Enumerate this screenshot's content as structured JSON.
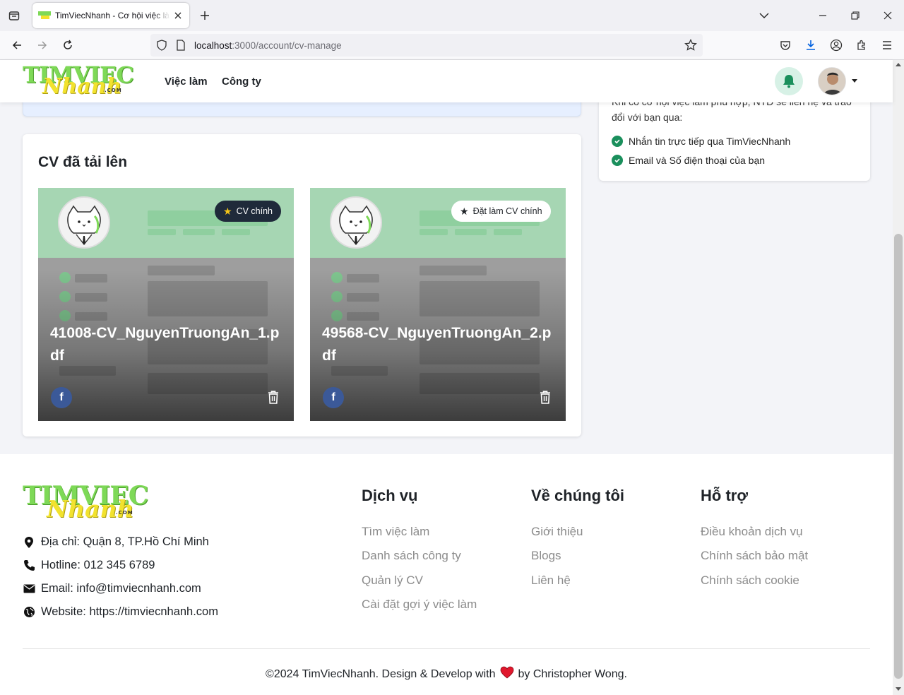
{
  "browser": {
    "tab_title": "TimViecNhanh - Cơ hội việc làm",
    "url_host": "localhost",
    "url_rest": ":3000/account/cv-manage"
  },
  "header": {
    "logo_top": "TIMVIEC",
    "logo_bottom": "Nhanh",
    "logo_com": ".COM",
    "menu": [
      "Việc làm",
      "Công ty"
    ]
  },
  "sidebar_card": {
    "clipped_text": "Khi có cơ hội việc làm phù hợp, NTD sẽ liên hệ và trao đổi với bạn qua:",
    "items": [
      "Nhắn tin trực tiếp qua TimViecNhanh",
      "Email và Số điện thoại của bạn"
    ]
  },
  "cv_section": {
    "title": "CV đã tải lên",
    "cards": [
      {
        "badge": "CV chính",
        "name": "41008-CV_NguyenTruongAn_1.pdf",
        "is_main": true
      },
      {
        "badge": "Đặt làm CV chính",
        "name": "49568-CV_NguyenTruongAn_2.pdf",
        "is_main": false
      }
    ]
  },
  "footer": {
    "logo_top": "TIMVIEC",
    "logo_bottom": "Nhanh",
    "logo_com": ".COM",
    "contacts": [
      {
        "icon": "location-pin-icon",
        "text": "Địa chỉ: Quận 8, TP.Hồ Chí Minh"
      },
      {
        "icon": "phone-icon",
        "text": "Hotline: 012 345 6789"
      },
      {
        "icon": "mail-icon",
        "text": "Email: info@timviecnhanh.com"
      },
      {
        "icon": "globe-icon",
        "text": "Website: https://timviecnhanh.com"
      }
    ],
    "columns": [
      {
        "title": "Dịch vụ",
        "links": [
          "Tìm việc làm",
          "Danh sách công ty",
          "Quản lý CV",
          "Cài đặt gợi ý việc làm"
        ]
      },
      {
        "title": "Về chúng tôi",
        "links": [
          "Giới thiệu",
          "Blogs",
          "Liên hệ"
        ]
      },
      {
        "title": "Hỗ trợ",
        "links": [
          "Điều khoản dịch vụ",
          "Chính sách bảo mật",
          "Chính sách cookie"
        ]
      }
    ],
    "copyright_before": "©2024 TimViecNhanh. Design & Develop with",
    "copyright_after": "by Christopher Wong."
  },
  "colors": {
    "accent_green": "#1a8f5c",
    "facebook_blue": "#3b5998",
    "badge_dark": "#1f2a3a",
    "heart_red": "#e0182d"
  }
}
